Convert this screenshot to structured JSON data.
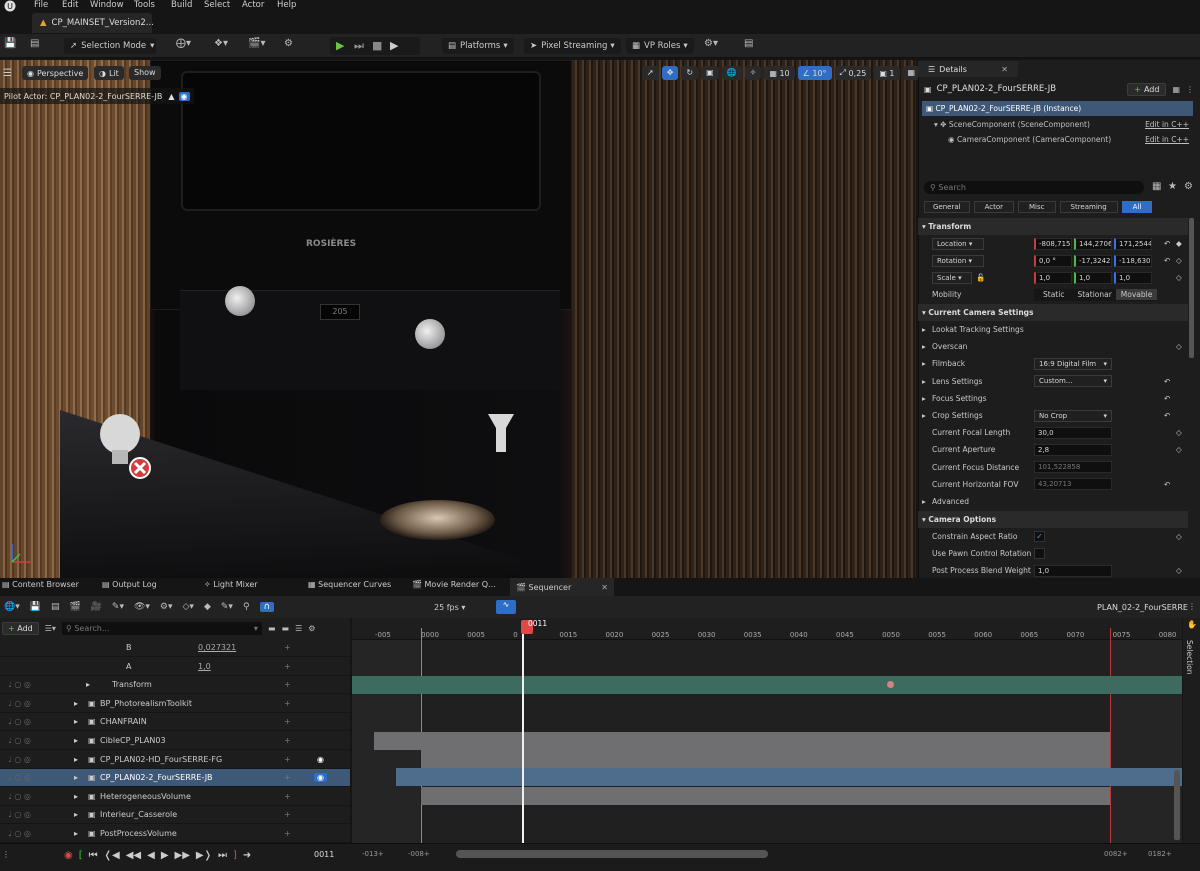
{
  "menu": [
    "File",
    "Edit",
    "Window",
    "Tools",
    "Build",
    "Select",
    "Actor",
    "Help"
  ],
  "doc_tab": "CP_MAINSET_Version2...",
  "toolbar": {
    "selection_mode": "Selection Mode",
    "platforms": "Platforms",
    "pixel_streaming": "Pixel Streaming",
    "vp_roles": "VP Roles"
  },
  "viewport": {
    "perspective": "Perspective",
    "lit": "Lit",
    "show": "Show",
    "pilot": "Pilot Actor: CP_PLAN02-2_FourSERRE-JB",
    "grid_snap": "10",
    "rot_snap": "10°",
    "scale_snap": "0,25",
    "cam_speed": "1",
    "brand": "ROSIÈRES",
    "display": "205"
  },
  "details": {
    "tab": "Details",
    "actor": "CP_PLAN02-2_FourSERRE-JB",
    "add": "Add",
    "components": [
      {
        "label": "CP_PLAN02-2_FourSERRE-JB (Instance)",
        "edit": ""
      },
      {
        "label": "SceneComponent (SceneComponent)",
        "edit": "Edit in C++"
      },
      {
        "label": "CameraComponent (CameraComponent)",
        "edit": "Edit in C++"
      }
    ],
    "search_placeholder": "Search",
    "filters": [
      "General",
      "Actor",
      "Misc",
      "Streaming",
      "All"
    ],
    "transform_header": "Transform",
    "location": {
      "label": "Location",
      "x": "-808,715¹",
      "y": "144,2706",
      "z": "171,2544¹"
    },
    "rotation": {
      "label": "Rotation",
      "x": "0,0 °",
      "y": "-17,3242°",
      "z": "-118,630°"
    },
    "scale": {
      "label": "Scale",
      "x": "1,0",
      "y": "1,0",
      "z": "1,0"
    },
    "mobility": {
      "label": "Mobility",
      "options": [
        "Static",
        "Stationar",
        "Movable"
      ]
    },
    "camera_settings_header": "Current Camera Settings",
    "rows": [
      {
        "label": "Lookat Tracking Settings",
        "value": "",
        "type": "expander"
      },
      {
        "label": "Overscan",
        "value": "",
        "type": "expander"
      },
      {
        "label": "Filmback",
        "value": "16:9 Digital Film",
        "type": "dropdown"
      },
      {
        "label": "Lens Settings",
        "value": "Custom...",
        "type": "dropdown"
      },
      {
        "label": "Focus Settings",
        "value": "",
        "type": "expander"
      },
      {
        "label": "Crop Settings",
        "value": "No Crop",
        "type": "dropdown"
      },
      {
        "label": "Current Focal Length",
        "value": "30,0",
        "type": "field"
      },
      {
        "label": "Current Aperture",
        "value": "2,8",
        "type": "field"
      },
      {
        "label": "Current Focus Distance",
        "value": "101,522858",
        "type": "field-dim"
      },
      {
        "label": "Current Horizontal FOV",
        "value": "43,20713",
        "type": "field-dim"
      },
      {
        "label": "Advanced",
        "value": "",
        "type": "expander"
      }
    ],
    "camera_options_header": "Camera Options",
    "options": [
      {
        "label": "Constrain Aspect Ratio",
        "value": "checked"
      },
      {
        "label": "Use Pawn Control Rotation",
        "value": "unchecked"
      },
      {
        "label": "Post Process Blend Weight",
        "value": "1,0"
      }
    ]
  },
  "bottom_tabs": [
    "Content Browser",
    "Output Log",
    "Light Mixer",
    "Sequencer Curves",
    "Movie Render Q...",
    "Sequencer"
  ],
  "sequencer": {
    "fps": "25 fps",
    "sequence_name": "PLAN_02-2_FourSERRE",
    "add": "Add",
    "search_placeholder": "Search...",
    "current_frame": "0011",
    "ticks": [
      "-005",
      "0000",
      "0005",
      "0",
      "0015",
      "0020",
      "0025",
      "0030",
      "0035",
      "0040",
      "0045",
      "0050",
      "0055",
      "0060",
      "0065",
      "0070",
      "0075",
      "0080"
    ],
    "tracks": [
      {
        "name": "B",
        "value": "0,027321"
      },
      {
        "name": "A",
        "value": "1,0"
      },
      {
        "name": "Transform",
        "value": ""
      },
      {
        "name": "BP_PhotorealismToolkit",
        "value": ""
      },
      {
        "name": "CHANFRAIN",
        "value": ""
      },
      {
        "name": "CibleCP_PLAN03",
        "value": ""
      },
      {
        "name": "CP_PLAN02-HD_FourSERRE-FG",
        "value": ""
      },
      {
        "name": "CP_PLAN02-2_FourSERRE-JB",
        "value": ""
      },
      {
        "name": "HeterogeneousVolume",
        "value": ""
      },
      {
        "name": "Interieur_Casserole",
        "value": ""
      },
      {
        "name": "PostProcessVolume",
        "value": ""
      }
    ],
    "range_start": "-013+",
    "range_in": "-008+",
    "range_out": "0082+",
    "range_end": "0182+",
    "frame_display": "0011",
    "selection_tab": "Selection"
  }
}
